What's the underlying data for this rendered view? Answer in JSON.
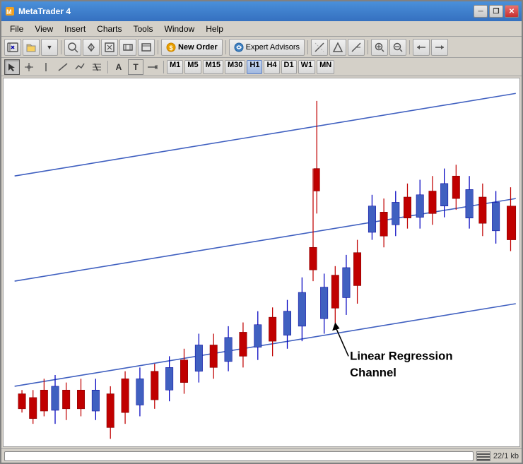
{
  "window": {
    "title": "MetaTrader 4",
    "title_btn_minimize": "─",
    "title_btn_restore": "❐",
    "title_btn_close": "✕"
  },
  "menu": {
    "items": [
      "File",
      "View",
      "Insert",
      "Charts",
      "Tools",
      "Window",
      "Help"
    ]
  },
  "toolbar": {
    "new_order_label": "New Order",
    "expert_advisors_label": "Expert Advisors"
  },
  "timeframes": [
    "M1",
    "M5",
    "M15",
    "M30",
    "H1",
    "H4",
    "D1",
    "W1",
    "MN"
  ],
  "chart": {
    "annotation": "Linear Regression\nChannel"
  },
  "status": {
    "info": "22/1 kb"
  }
}
